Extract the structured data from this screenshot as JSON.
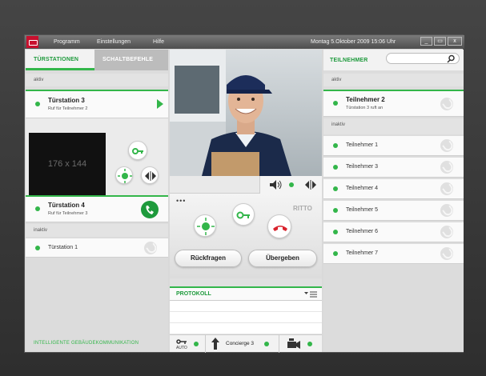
{
  "titlebar": {
    "menu": [
      "Programm",
      "Einstellungen",
      "Hilfe"
    ],
    "datetime": "Montag 5.Oktober 2009   15:06 Uhr",
    "buttons": [
      "_",
      "▭",
      "x"
    ]
  },
  "left": {
    "tabs": [
      "TÜRSTATIONEN",
      "SCHALTBEFEHLE"
    ],
    "active_label": "aktiv",
    "inactive_label": "inaktiv",
    "stations_active": [
      {
        "title": "Türstation 3",
        "subtitle": "Ruf für Teilnehmer 2"
      },
      {
        "title": "Türstation 4",
        "subtitle": "Ruf für Teilnehmer 3"
      }
    ],
    "preview_label": "176 x 144",
    "stations_inactive": [
      {
        "title": "Türstation 1"
      }
    ],
    "footer": "INTELLIGENTE GEBÄUDEKOMMUNIKATION"
  },
  "center": {
    "dots": "•••",
    "brand": "RITTO",
    "buttons": {
      "back": "Rückfragen",
      "handover": "Übergeben"
    },
    "protocol_title": "PROTOKOLL",
    "bottom": {
      "auto_label": "AUTO",
      "concierge": "Concierge 3"
    }
  },
  "right": {
    "header": "TEILNEHMER",
    "search_placeholder": "",
    "active_label": "aktiv",
    "inactive_label": "inaktiv",
    "active_participant": {
      "title": "Teilnehmer 2",
      "subtitle": "Türstation 3 ruft an"
    },
    "participants": [
      "Teilnehmer 1",
      "Teilnehmer 3",
      "Teilnehmer 4",
      "Teilnehmer 5",
      "Teilnehmer 6",
      "Teilnehmer 7"
    ]
  },
  "colors": {
    "accent": "#33b64a",
    "brand_red": "#c8102e",
    "hangup_red": "#d9232d"
  }
}
